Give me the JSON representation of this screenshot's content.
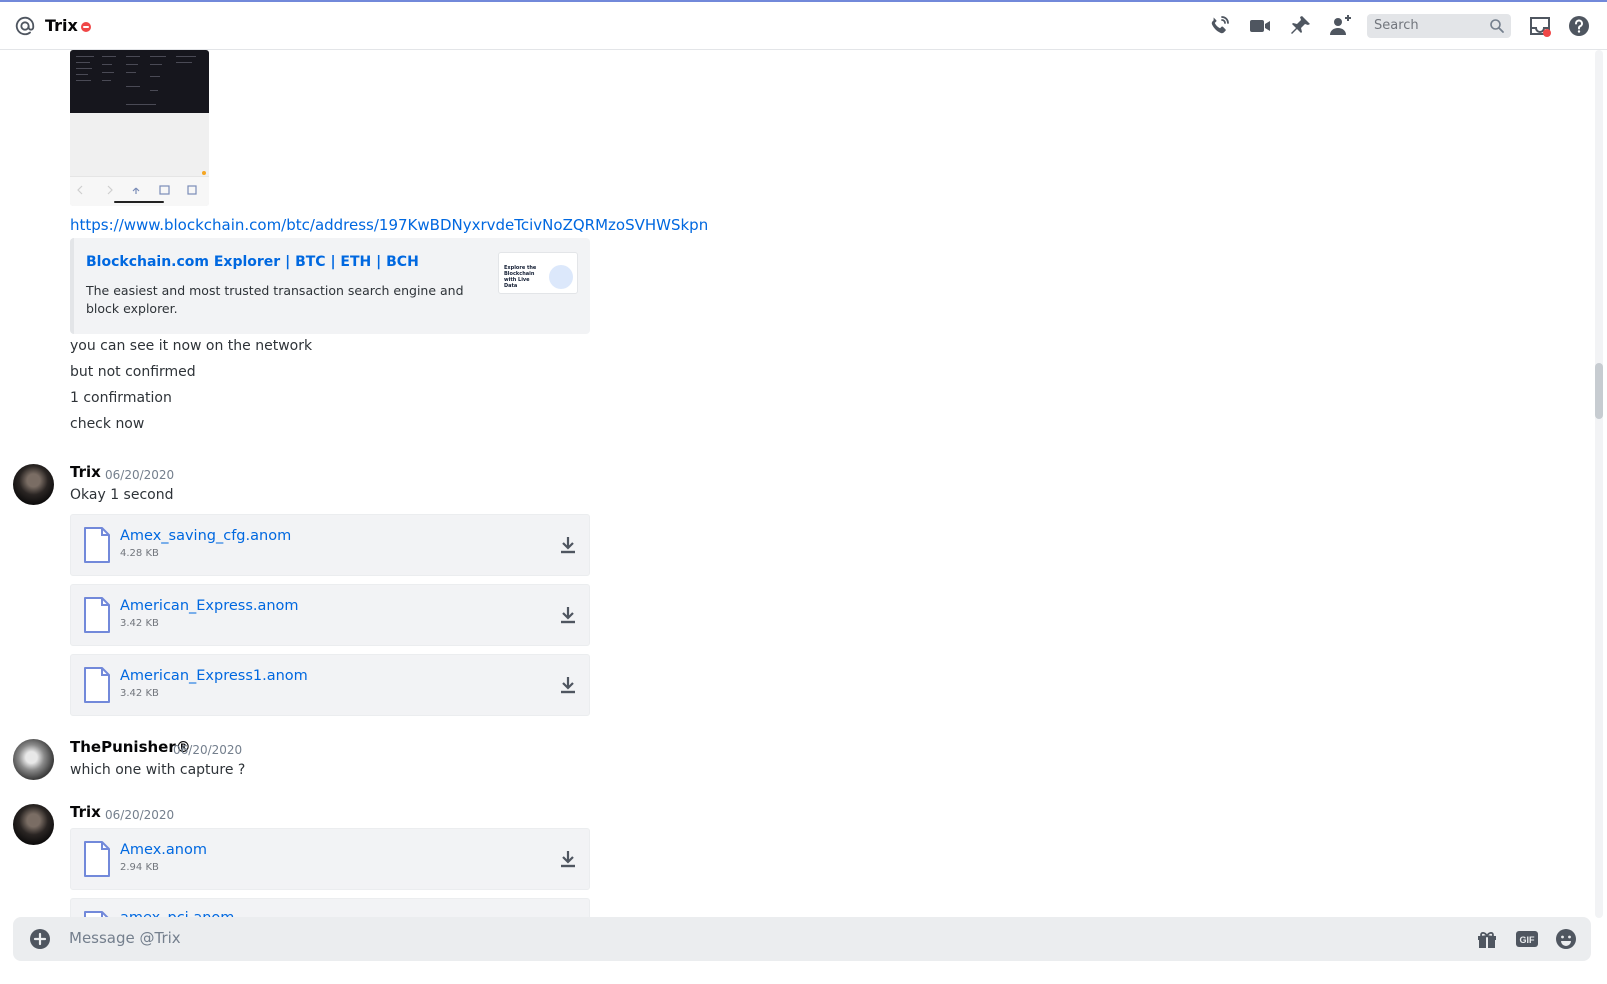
{
  "header": {
    "title": "Trix",
    "search_placeholder": "Search"
  },
  "messages": {
    "link": {
      "url": "https://www.blockchain.com/btc/address/197KwBDNyxrvdeTcivNoZQRMzoSVHWSkpn",
      "embed_title": "Blockchain.com Explorer | BTC | ETH | BCH",
      "embed_description": "The easiest and most trusted transaction search engine and block explorer.",
      "thumb_text": "Explore the Blockchain with Live Data"
    },
    "lines": [
      "you can see it now on the network",
      "but not confirmed",
      "1 confirmation",
      "check now"
    ],
    "group1": {
      "author": "Trix",
      "timestamp": "06/20/2020",
      "text": "Okay 1 second",
      "attachments": [
        {
          "name": "Amex_saving_cfg.anom",
          "size": "4.28 KB"
        },
        {
          "name": "American_Express.anom",
          "size": "3.42 KB"
        },
        {
          "name": "American_Express1.anom",
          "size": "3.42 KB"
        }
      ]
    },
    "group2": {
      "author": "ThePunisher®",
      "timestamp": "06/20/2020",
      "text": "which one with capture ?"
    },
    "group3": {
      "author": "Trix",
      "timestamp": "06/20/2020",
      "attachments": [
        {
          "name": "Amex.anom",
          "size": "2.94 KB"
        },
        {
          "name": "amex_pci.anom",
          "size": ""
        }
      ]
    }
  },
  "composer": {
    "placeholder": "Message @Trix",
    "gif_label": "GIF"
  },
  "colors": {
    "accent": "#7289da",
    "link": "#0068e0",
    "dnd": "#f04747"
  }
}
